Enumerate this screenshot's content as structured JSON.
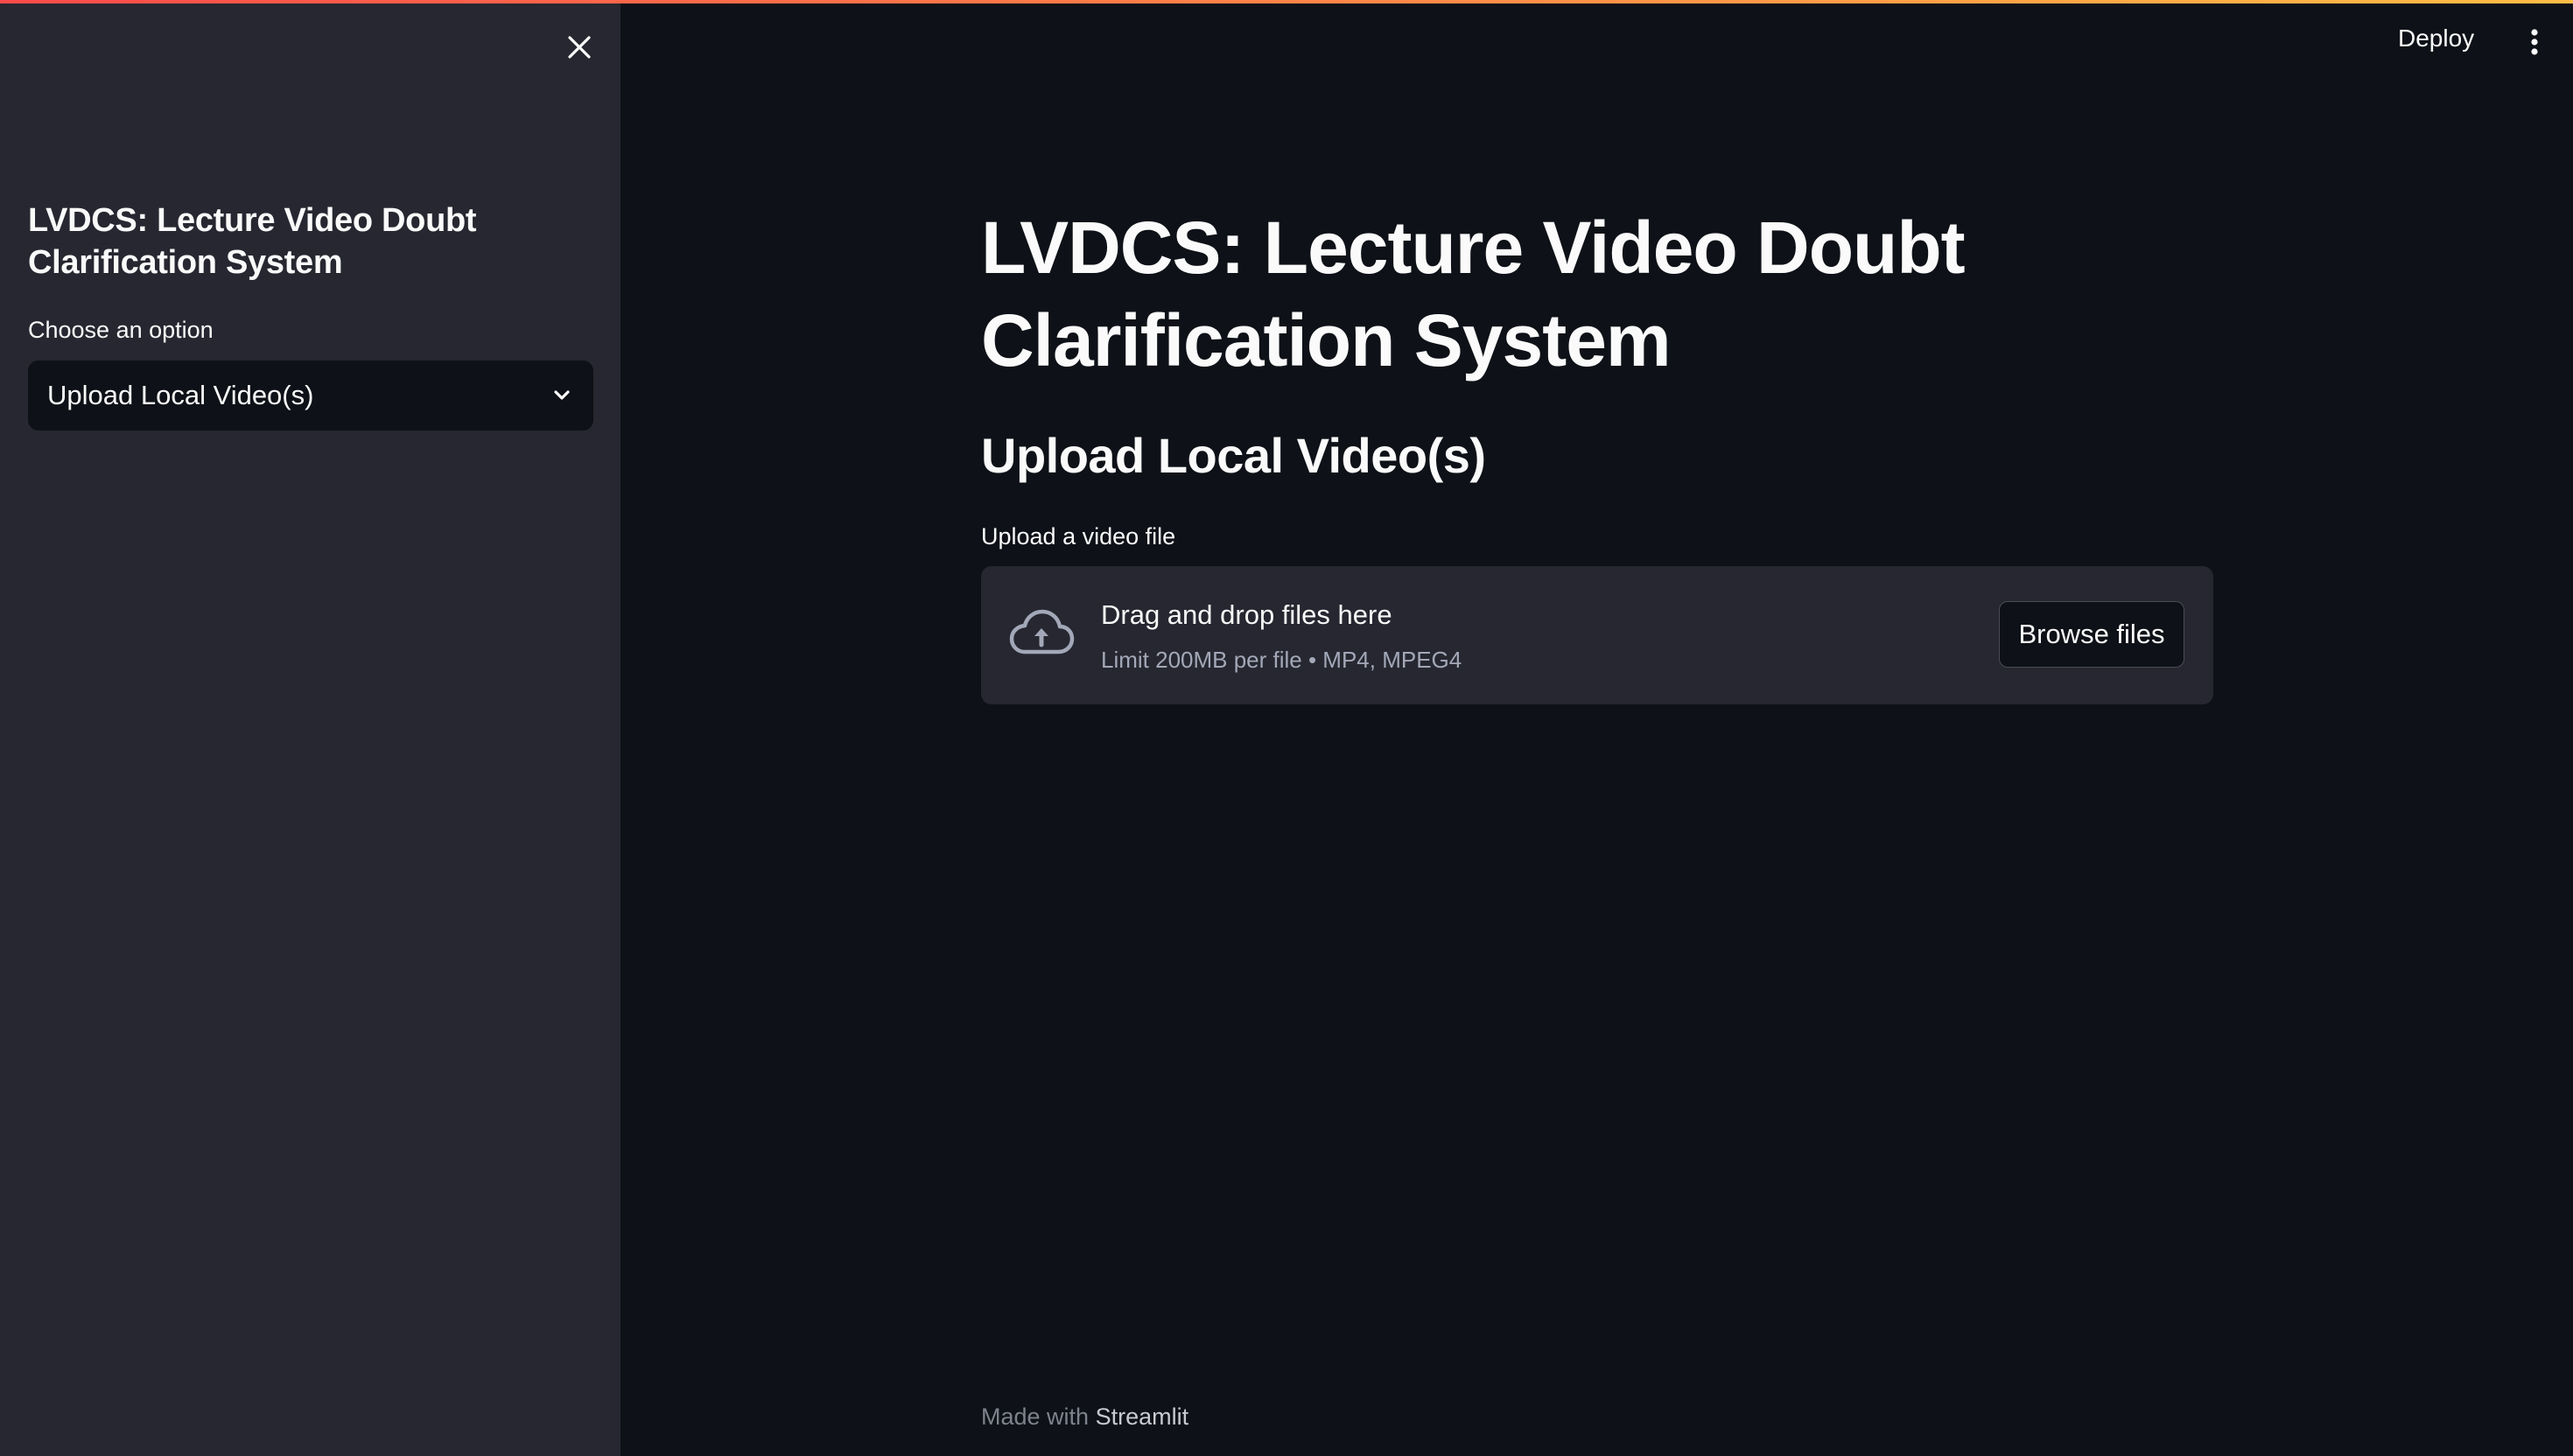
{
  "header": {
    "deploy_label": "Deploy",
    "menu_icon": "vertical-dots-icon"
  },
  "sidebar": {
    "close_icon": "close-icon",
    "title": "LVDCS: Lecture Video Doubt Clarification System",
    "select": {
      "label": "Choose an option",
      "value": "Upload Local Video(s)",
      "icon": "chevron-down-icon"
    }
  },
  "main": {
    "title": "LVDCS: Lecture Video Doubt Clarification System",
    "subtitle": "Upload Local Video(s)",
    "uploader": {
      "label": "Upload a video file",
      "icon": "cloud-upload-icon",
      "drop_text": "Drag and drop files here",
      "limit_text": "Limit 200MB per file • MP4, MPEG4",
      "browse_label": "Browse files"
    }
  },
  "footer": {
    "prefix": "Made with",
    "link": "Streamlit"
  },
  "colors": {
    "background": "#0e1117",
    "sidebar": "#262730",
    "accent_start": "#ff4b4b",
    "accent_end": "#ffbd45",
    "muted_text": "#a3a8b8"
  }
}
